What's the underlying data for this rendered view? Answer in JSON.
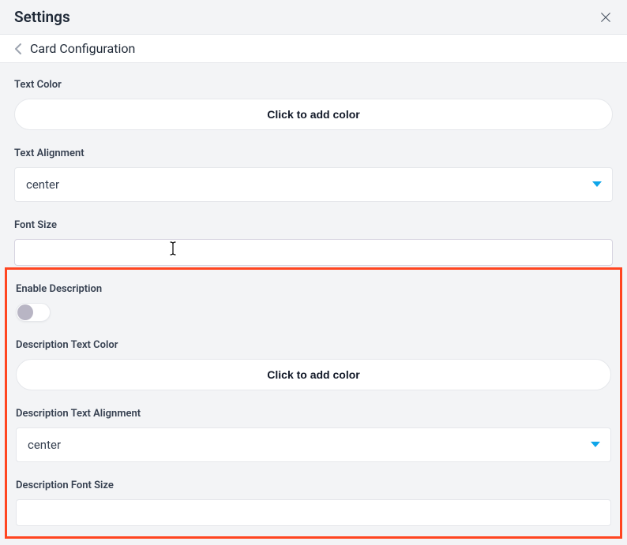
{
  "header": {
    "title": "Settings"
  },
  "subheader": {
    "title": "Card Configuration"
  },
  "fields": {
    "textColor": {
      "label": "Text Color",
      "button": "Click to add color"
    },
    "textAlignment": {
      "label": "Text Alignment",
      "value": "center"
    },
    "fontSize": {
      "label": "Font Size",
      "value": ""
    },
    "enableDescription": {
      "label": "Enable Description",
      "value": false
    },
    "descTextColor": {
      "label": "Description Text Color",
      "button": "Click to add color"
    },
    "descTextAlignment": {
      "label": "Description Text Alignment",
      "value": "center"
    },
    "descFontSize": {
      "label": "Description Font Size",
      "value": ""
    }
  }
}
